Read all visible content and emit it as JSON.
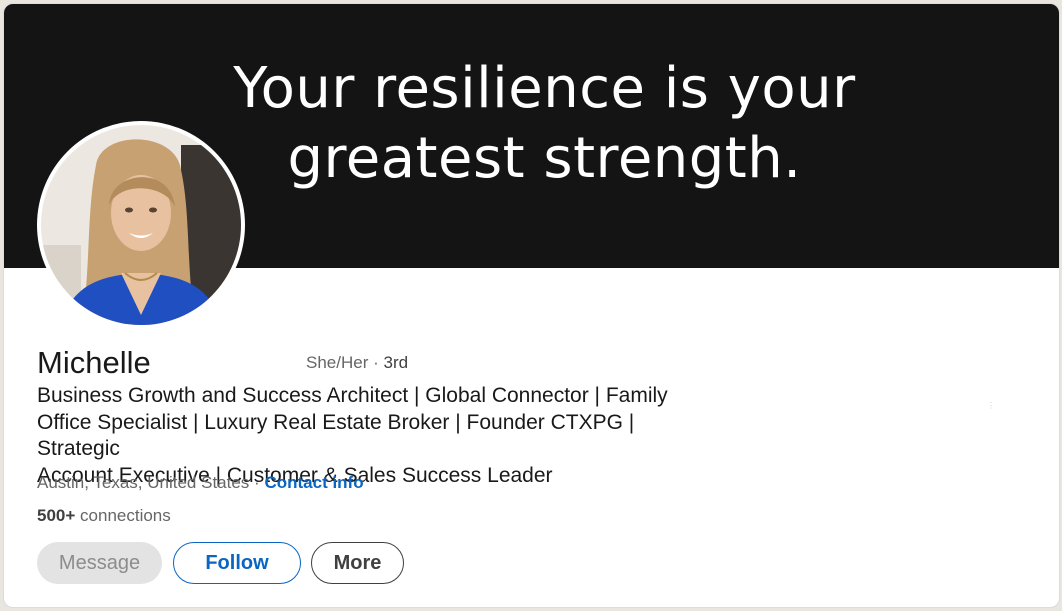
{
  "banner": {
    "line1": "Your resilience is your",
    "line2": "greatest strength."
  },
  "profile": {
    "name": "Michelle",
    "pronouns": "She/Her",
    "separator": "·",
    "degree": "3rd",
    "headline_lines": [
      "Business Growth and Success Architect | Global Connector | Family",
      "Office Specialist | Luxury Real Estate Broker | Founder CTXPG | Strategic",
      "Account Executive | Customer & Sales Success Leader"
    ],
    "location": "Austin, Texas, United States",
    "contact_info_label": "Contact info",
    "connections_count": "500+",
    "connections_label": "connections"
  },
  "actions": {
    "message_label": "Message",
    "follow_label": "Follow",
    "more_label": "More"
  },
  "colors": {
    "accent": "#0a66c2",
    "banner_bg": "#141414",
    "avatar_top": "#f2efe9",
    "dress": "#1f4fc0",
    "hair": "#c7a172"
  }
}
